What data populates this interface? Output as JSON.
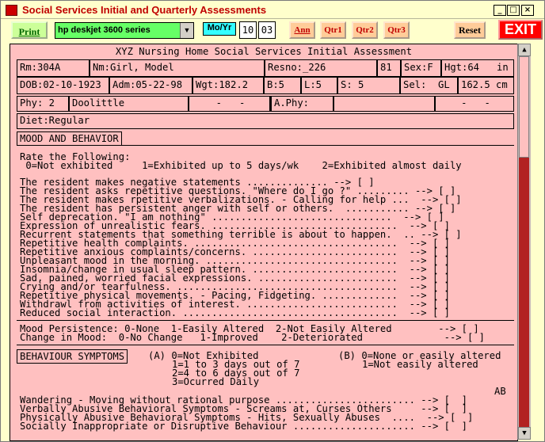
{
  "window": {
    "title": "Social Services Initial and Quarterly Assessments"
  },
  "toolbar": {
    "print": "Print",
    "printer": "hp deskjet 3600 series",
    "moyr": "Mo/Yr",
    "month": "10",
    "year": "03",
    "ann": "Ann",
    "qtr1": "Qtr1",
    "qtr2": "Qtr2",
    "qtr3": "Qtr3",
    "reset": "Reset",
    "exit": "EXIT"
  },
  "form": {
    "heading": "XYZ Nursing Home Social Services Initial Assessment",
    "rm": "Rm:304A",
    "nm": "Nm:Girl, Model",
    "resno": "Resno:_226",
    "age": "81",
    "sex": "Sex:F",
    "hgt": "Hgt:64   in",
    "dob": "DOB:02-10-1923",
    "adm": "Adm:05-22-98",
    "wgt": "Wgt:182.2",
    "b": "B:5",
    "l": "L:5",
    "s": "S: 5",
    "sel": "Sel:  GL",
    "cm": "162.5 cm",
    "phy": "Phy: 2",
    "phy_name": "Doolittle",
    "phy_dash": "-   -",
    "aphy": "A.Phy:",
    "aphy_dash": "-   -",
    "diet": "Diet:Regular",
    "mood_title": "MOOD AND BEHAVIOR",
    "rate_line": "Rate the Following:",
    "scale_line": " 0=Not exhibited     1=Exhibited up to 5 days/wk    2=Exhibited almost daily",
    "mood_items": [
      "The resident makes negative statements .............. --> [ ]",
      "The resident asks repetitive questions. \"Where do I go ?\" ......... --> [ ]",
      "The resident makes rpetitive verbalizations. - Calling for help ...  --> [ ]",
      "The resident has persistent anger with self or others.  ........... --> [ ]",
      "Self deprecation. \"I am nothing\" ...............................  --> [ ]",
      "Expression of unrealistic fears. ................................  --> [ ]",
      "Recurrent statements that something terrible is about to happen.  .. --> [ ]",
      "Repetitive health complaints. ...................................  --> [ ]",
      "Repetitive anxious complaints/concerns. .........................  --> [ ]",
      "Unpleasant mood in the morning. .................................  --> [ ]",
      "Insomnia/change in usual sleep pattern. .........................  --> [ ]",
      "Sad, pained, worried facial expressions. ........................  --> [ ]",
      "Crying and/or tearfulness. ......................................  --> [ ]",
      "Repetitive physical movements. - Pacing, Fidgeting. .............  --> [ ]",
      "Withdrawl from activities of interest. ..........................  --> [ ]",
      "Reduced social interaction. .....................................  --> [ ]"
    ],
    "persistence": "Mood Persistence: 0-None  1-Easily Altered  2-Not Easily Altered        --> [ ]",
    "change": "Change in Mood:  0-No Change   1-Improved    2-Deteriorated              --> [ ]",
    "behav_title": "BEHAVIOUR SYMPTOMS",
    "behav_a1": "(A) 0=Not Exhibited",
    "behav_a2": "1=1 to 3 days out of 7",
    "behav_a3": "2=4 to 6 days out of 7",
    "behav_a4": "3=Ocurred Daily",
    "behav_b1": "(B) 0=None or easily altered",
    "behav_b2": "1=Not easily altered",
    "ab": "AB",
    "behav_items": [
      "Wandering - Moving without rational purpose ........................ --> [  ]",
      "Verbally Abusive Behavioral Symptoms - Screams at, Curses Others     --> [  ]",
      "Physically Abusive Behavioral Symptoms - Hits, Sexually Abuses  ....  --> [  ]",
      "Socially Inappropriate or Disruptive Behaviour ..................... --> [  ]"
    ]
  }
}
